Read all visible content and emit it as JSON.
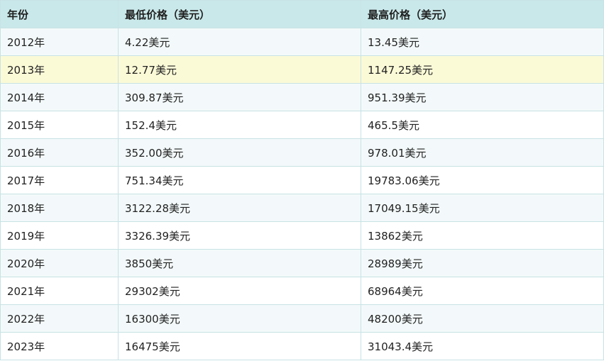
{
  "table": {
    "headers": [
      "年份",
      "最低价格（美元）",
      "最高价格（美元）"
    ],
    "rows": [
      [
        "2012年",
        "4.22美元",
        "13.45美元"
      ],
      [
        "2013年",
        "12.77美元",
        "1147.25美元"
      ],
      [
        "2014年",
        "309.87美元",
        "951.39美元"
      ],
      [
        "2015年",
        "152.4美元",
        "465.5美元"
      ],
      [
        "2016年",
        "352.00美元",
        "978.01美元"
      ],
      [
        "2017年",
        "751.34美元",
        "19783.06美元"
      ],
      [
        "2018年",
        "3122.28美元",
        "17049.15美元"
      ],
      [
        "2019年",
        "3326.39美元",
        "13862美元"
      ],
      [
        "2020年",
        "3850美元",
        "28989美元"
      ],
      [
        "2021年",
        "29302美元",
        "68964美元"
      ],
      [
        "2022年",
        "16300美元",
        "48200美元"
      ],
      [
        "2023年",
        "16475美元",
        "31043.4美元"
      ]
    ],
    "highlighted_row_index": 1,
    "colors": {
      "header_bg": "#c9e8ea",
      "odd_row_bg": "#f3f9fa",
      "even_row_bg": "#ffffff",
      "highlight_bg": "#fbfad7",
      "border": "#c8e2e4"
    }
  }
}
